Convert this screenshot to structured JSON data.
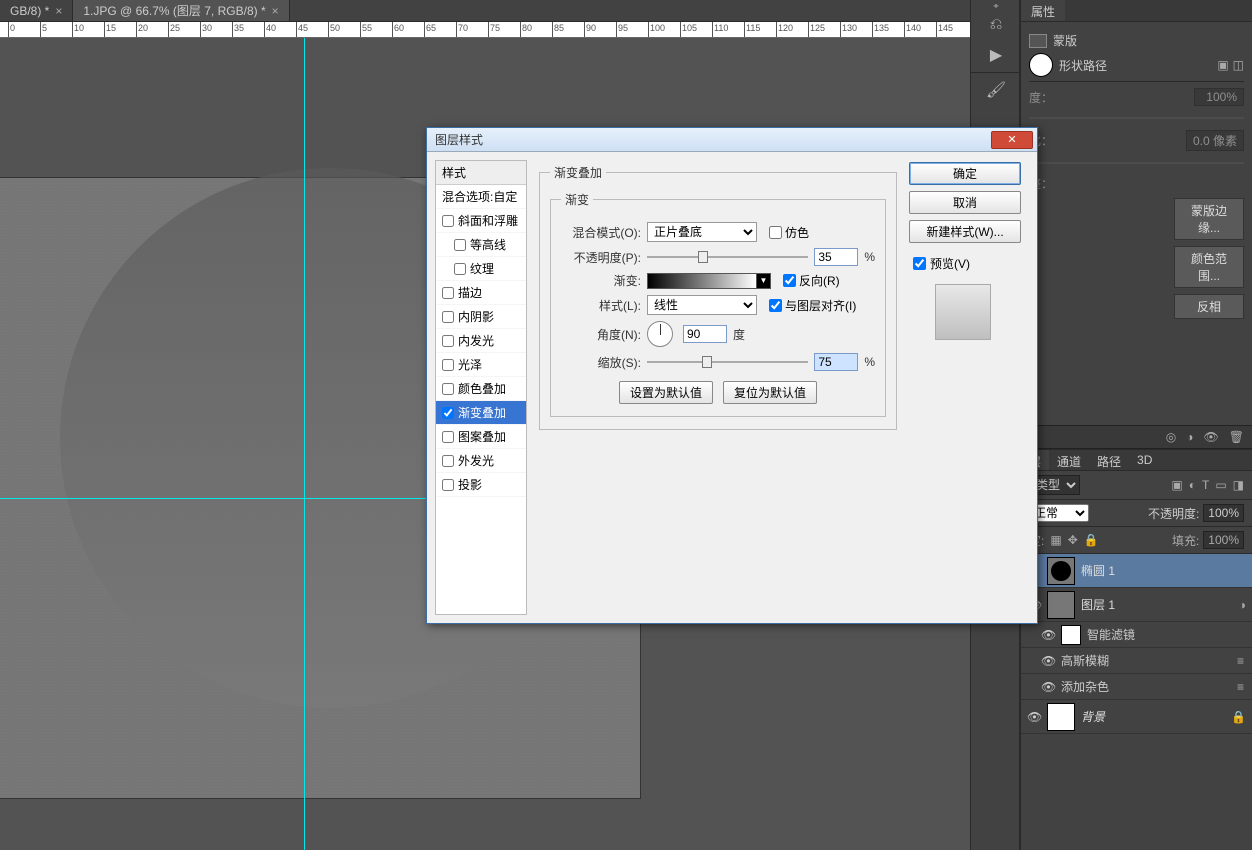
{
  "tabs": [
    {
      "label": "GB/8) *"
    },
    {
      "label": "1.JPG @ 66.7% (图层 7, RGB/8) *"
    }
  ],
  "ruler_numbers": [
    0,
    5,
    10,
    15,
    20,
    25,
    30,
    35,
    40,
    45,
    50,
    55,
    60,
    65,
    70,
    75,
    80,
    85,
    90,
    95,
    100,
    105,
    110,
    115,
    120,
    125,
    130,
    135,
    140,
    145
  ],
  "props": {
    "tab": "属性",
    "mask_label": "蒙版",
    "shape_path": "形状路径",
    "density_label": "度：",
    "density_value": "100%",
    "feather_label": "化：",
    "feather_value": "0.0 像素",
    "adjust_label": "整：",
    "btn_mask_edge": "蒙版边缘...",
    "btn_color_range": "颜色范围...",
    "btn_invert": "反相"
  },
  "layer_panel": {
    "tabs": [
      "层",
      "通道",
      "路径",
      "3D"
    ],
    "kind": "类型",
    "blend": "正常",
    "opacity_label": "不透明度:",
    "opacity_value": "100%",
    "lock_label": "定:",
    "fill_label": "填充:",
    "fill_value": "100%"
  },
  "layers": [
    {
      "eye": false,
      "name": "椭圆 1",
      "type": "shape",
      "selected": true,
      "lock": false
    },
    {
      "eye": true,
      "name": "图层 1",
      "type": "smart",
      "selected": false,
      "lock": false,
      "vis_icon": true
    }
  ],
  "smart_filters": {
    "header": "智能滤镜",
    "items": [
      {
        "name": "高斯模糊"
      },
      {
        "name": "添加杂色"
      }
    ]
  },
  "bg_layer": {
    "name": "背景"
  },
  "dialog": {
    "title": "图层样式",
    "styles_header": "样式",
    "blend_options": "混合选项:自定",
    "style_items": [
      {
        "label": "斜面和浮雕",
        "checked": false
      },
      {
        "label": "等高线",
        "checked": false,
        "sub": true
      },
      {
        "label": "纹理",
        "checked": false,
        "sub": true
      },
      {
        "label": "描边",
        "checked": false
      },
      {
        "label": "内阴影",
        "checked": false
      },
      {
        "label": "内发光",
        "checked": false
      },
      {
        "label": "光泽",
        "checked": false
      },
      {
        "label": "颜色叠加",
        "checked": false
      },
      {
        "label": "渐变叠加",
        "checked": true,
        "selected": true
      },
      {
        "label": "图案叠加",
        "checked": false
      },
      {
        "label": "外发光",
        "checked": false
      },
      {
        "label": "投影",
        "checked": false
      }
    ],
    "section_title": "渐变叠加",
    "subsection_title": "渐变",
    "mix_mode_label": "混合模式(O):",
    "mix_mode_value": "正片叠底",
    "dither_label": "仿色",
    "opacity_label": "不透明度(P):",
    "opacity_value": "35",
    "percent": "%",
    "gradient_label": "渐变:",
    "reverse_label": "反向(R)",
    "style_label": "样式(L):",
    "style_value": "线性",
    "align_label": "与图层对齐(I)",
    "angle_label": "角度(N):",
    "angle_value": "90",
    "angle_unit": "度",
    "scale_label": "缩放(S):",
    "scale_value": "75",
    "set_default": "设置为默认值",
    "reset_default": "复位为默认值",
    "ok": "确定",
    "cancel": "取消",
    "new_style": "新建样式(W)...",
    "preview": "预览(V)"
  }
}
